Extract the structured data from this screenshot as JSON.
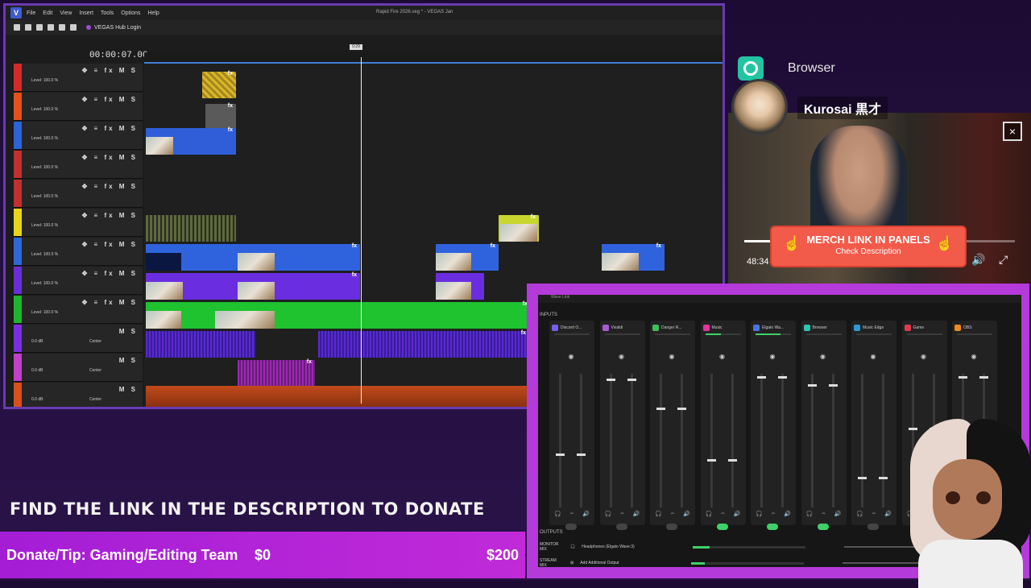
{
  "vegas": {
    "logo": "V",
    "menu": [
      "File",
      "Edit",
      "View",
      "Insert",
      "Tools",
      "Options",
      "Help"
    ],
    "window_title": "Rapid Fire 2026.veg * - VEGAS",
    "user_badge": "Jan",
    "hub_login": "VEGAS Hub Login",
    "timecode": "00:00:07.00",
    "playhead_label": "0:29",
    "tracks": [
      {
        "level": "Level: 100.0 %",
        "color": "#d42a2a",
        "type": "video"
      },
      {
        "level": "Level: 100.0 %",
        "color": "#e4511c",
        "type": "video"
      },
      {
        "level": "Level: 100.0 %",
        "color": "#2c63d6",
        "type": "video"
      },
      {
        "level": "Level: 100.0 %",
        "color": "#c03030",
        "type": "video"
      },
      {
        "level": "Level: 100.0 %",
        "color": "#c03030",
        "type": "video"
      },
      {
        "level": "Level: 100.0 %",
        "color": "#e8d51a",
        "type": "video"
      },
      {
        "level": "Level: 100.0 %",
        "color": "#2d6ad8",
        "type": "video"
      },
      {
        "level": "Level: 100.0 %",
        "color": "#6a2ed8",
        "type": "video"
      },
      {
        "level": "Level: 100.0 %",
        "color": "#1fb52f",
        "type": "video"
      },
      {
        "level": "0.0 dB",
        "pan": "Center",
        "color": "#7b2ee0",
        "type": "audio"
      },
      {
        "level": "0.0 dB",
        "pan": "Center",
        "color": "#c040c8",
        "type": "audio"
      },
      {
        "level": "0.0 dB",
        "pan": "Center",
        "color": "#d8501a",
        "type": "audio"
      }
    ],
    "track_controls": "✥ ≡ fx M S",
    "audio_controls": "M S"
  },
  "browser": {
    "label": "Browser",
    "username": "Kurosai 黒才",
    "video_time": "48:34",
    "progress": 0.82,
    "close_icon": "×",
    "merch_title": "MERCH LINK IN PANELS",
    "merch_sub": "Check Description"
  },
  "wave": {
    "title": "Wave Link",
    "inputs_label": "INPUTS",
    "outputs_label": "OUTPUTS",
    "channels": [
      {
        "name": "Discord O...",
        "color": "#7360e8",
        "level": 0.0,
        "fader": 0.62,
        "active": false
      },
      {
        "name": "Vivaldi",
        "color": "#a75bd9",
        "level": 0.0,
        "fader": 0.04,
        "active": false
      },
      {
        "name": "Danger R...",
        "color": "#3fbe5e",
        "level": 0.0,
        "fader": 0.26,
        "active": false
      },
      {
        "name": "Music",
        "color": "#e0359c",
        "level": 0.45,
        "fader": 0.66,
        "active": true
      },
      {
        "name": "Elgato Wa...",
        "color": "#4b74e0",
        "level": 0.7,
        "fader": 0.02,
        "active": true
      },
      {
        "name": "Browser",
        "color": "#2cc4b0",
        "level": 0.0,
        "fader": 0.08,
        "active": true
      },
      {
        "name": "Music Edge",
        "color": "#2d98d8",
        "level": 0.0,
        "fader": 0.8,
        "active": false
      },
      {
        "name": "Game",
        "color": "#e03a4a",
        "level": 0.0,
        "fader": 0.42,
        "active": false
      },
      {
        "name": "OBS",
        "color": "#f08a1c",
        "level": 0.0,
        "fader": 0.02,
        "active": false
      }
    ],
    "outputs": [
      {
        "label": "MONITOR MIX",
        "device": "Headphones (Elgato Wave:3)",
        "level": 0.15
      },
      {
        "label": "STREAM MIX",
        "device": "Add Additional Output",
        "level": 0.12
      }
    ]
  },
  "donation": {
    "find_link": "FIND THE LINK IN THE DESCRIPTION TO DONATE",
    "label": "Donate/Tip: Gaming/Editing Team",
    "current": "$0",
    "goal": "$200"
  },
  "colors": {
    "accent": "#b43ad9",
    "donate_bar": "#a41ed6",
    "merch": "#f25a4a"
  }
}
